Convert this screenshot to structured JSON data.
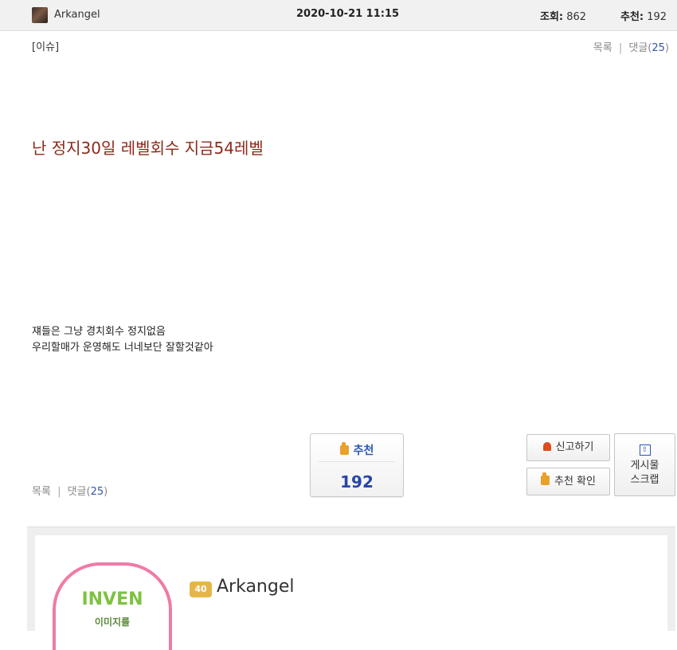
{
  "post": {
    "author": "Arkangel",
    "datetime": "2020-10-21 11:15",
    "views_label": "조회:",
    "views": "862",
    "recs_label": "추천:",
    "recs": "192",
    "tag": "[이슈]",
    "title": "난 정지30일 레벨회수 지금54레벨",
    "body_lines": [
      "쟤들은 그냥 경치회수 정지없음",
      "우리할매가 운영해도 너네보단 잘할것같아"
    ]
  },
  "links": {
    "list": "목록",
    "sep": "|",
    "comments_prefix": "댓글(",
    "comments_count": "25",
    "comments_suffix": ")"
  },
  "recommend": {
    "label": "추천",
    "count": "192"
  },
  "buttons": {
    "report": "신고하기",
    "rec_check": "추천 확인",
    "scrap_line1": "게시물",
    "scrap_line2": "스크랩"
  },
  "profile": {
    "logo_text": "INVEN",
    "logo_sub": "이미지를",
    "level": "40",
    "name": "Arkangel"
  },
  "colors": {
    "title": "#8b2a1a",
    "accent_blue": "#2c58b3",
    "logo_green": "#7dc240",
    "badge_pink": "#f07aa6"
  },
  "icons": [
    "thumbs-up-icon",
    "alarm-icon",
    "scrap-icon",
    "avatar"
  ]
}
